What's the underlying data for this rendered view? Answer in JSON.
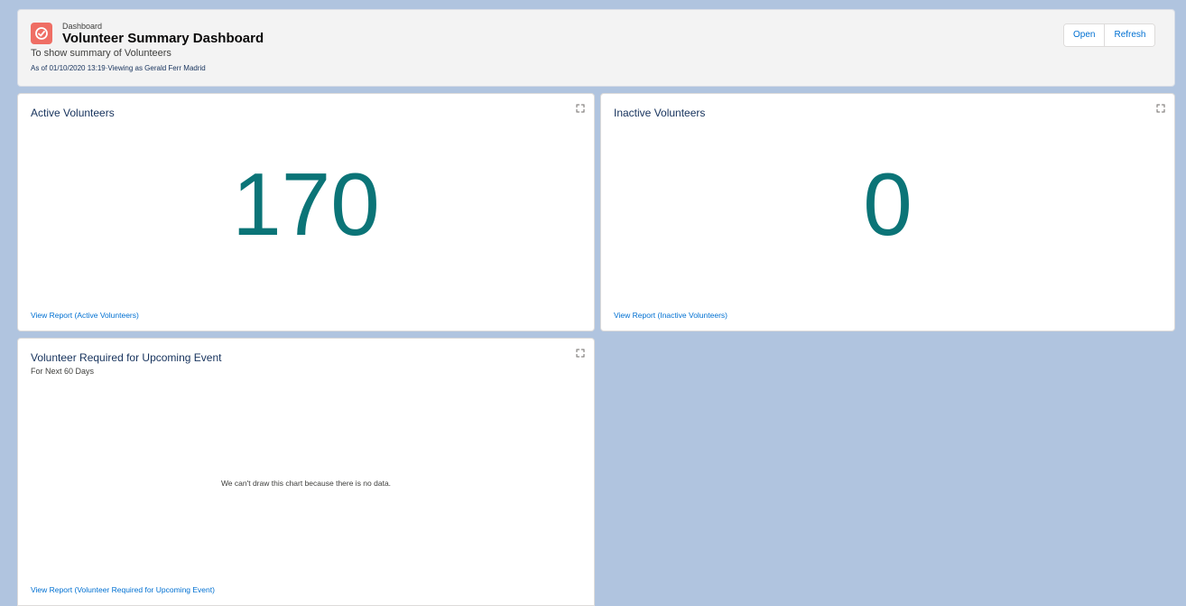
{
  "header": {
    "eyebrow": "Dashboard",
    "title": "Volunteer Summary Dashboard",
    "description": "To show summary of Volunteers",
    "as_of": "As of 01/10/2020 13:19·Viewing as Gerald Ferr Madrid",
    "icon": "dashboard-gauge-icon",
    "icon_color": "#ef6e64",
    "buttons": {
      "open": "Open",
      "refresh": "Refresh"
    }
  },
  "components": [
    {
      "title": "Active Volunteers",
      "value": "170",
      "link": "View Report (Active Volunteers)",
      "icon": "expand-icon"
    },
    {
      "title": "Inactive Volunteers",
      "value": "0",
      "link": "View Report (Inactive Volunteers)",
      "icon": "expand-icon"
    },
    {
      "title": "Volunteer Required for Upcoming Event",
      "subtitle": "For Next 60 Days",
      "empty_message": "We can't draw this chart because there is no data.",
      "link": "View Report (Volunteer Required for Upcoming Event)",
      "icon": "expand-icon"
    }
  ],
  "colors": {
    "background": "#b0c4df",
    "metric": "#0b7477",
    "link": "#0070d2"
  }
}
